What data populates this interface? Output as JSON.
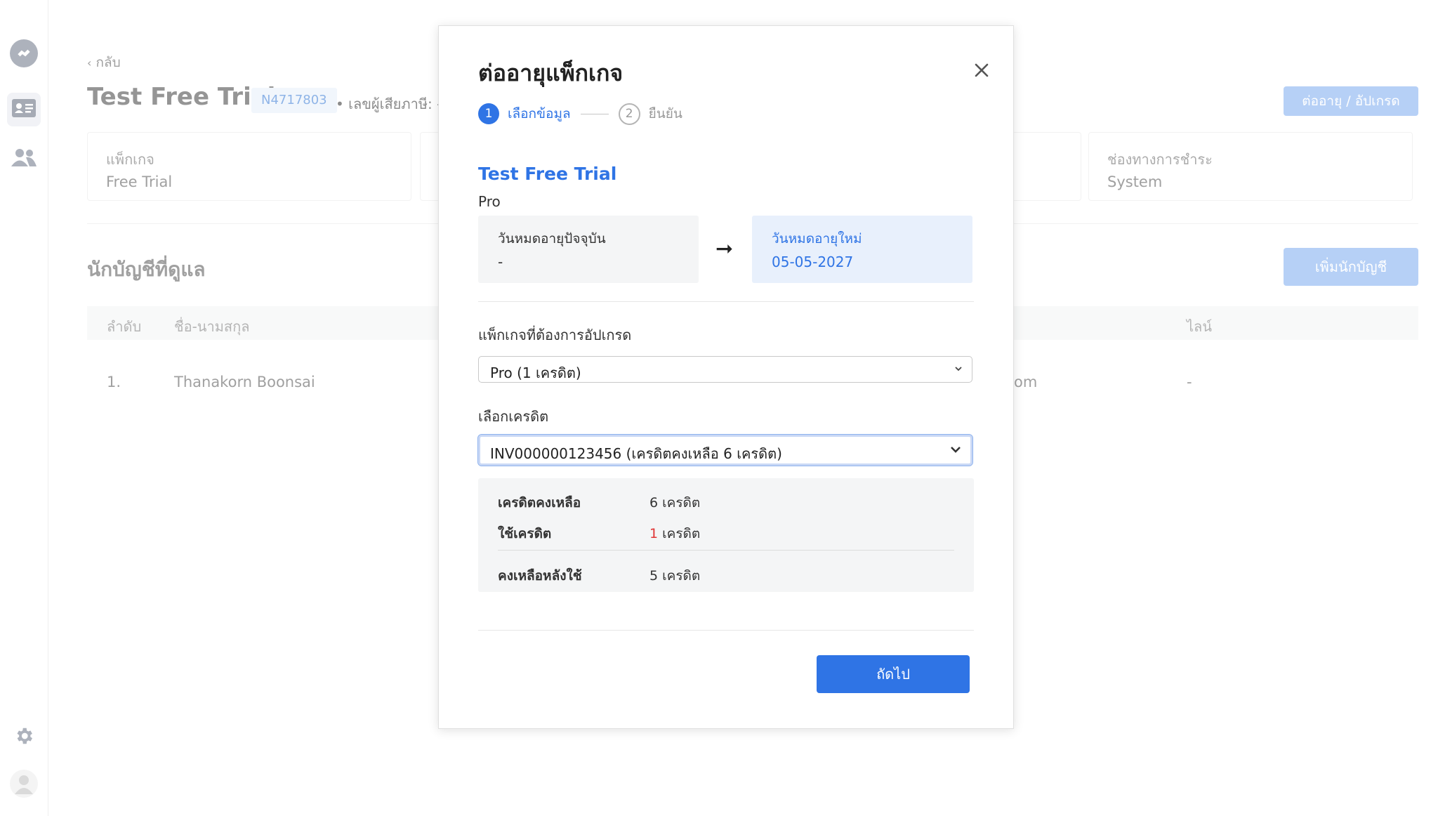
{
  "background": {
    "back_label": "กลับ",
    "page_title": "Test Free Trial",
    "id_badge": "N4717803",
    "tax_label": "• เลขผู้เสียภาษี: -",
    "renew_button": "ต่ออายุ / อัปเกรด",
    "info_cards": [
      {
        "label": "แพ็กเกจ",
        "value": "Free Trial"
      },
      {
        "label": "ช่องทางการชำระ",
        "value": "System"
      }
    ],
    "section_title": "นักบัญชีที่ดูแล",
    "add_button": "เพิ่มนักบัญชี",
    "table": {
      "headers": [
        "ลำดับ",
        "ชื่อ-นามสกุล",
        "ไลน์"
      ],
      "rows": [
        {
          "index": "1.",
          "name": "Thanakorn Boonsai",
          "email_tail": "om",
          "line": "-"
        }
      ]
    }
  },
  "modal": {
    "title": "ต่ออายุแพ็กเกจ",
    "steps": [
      {
        "number": "1",
        "label": "เลือกข้อมูล",
        "active": true
      },
      {
        "number": "2",
        "label": "ยืนยัน",
        "active": false
      }
    ],
    "package_name": "Test Free Trial",
    "package_tier": "Pro",
    "current_expiry": {
      "label": "วันหมดอายุปัจจุบัน",
      "value": "-"
    },
    "new_expiry": {
      "label": "วันหมดอายุใหม่",
      "value": "05-05-2027"
    },
    "upgrade_label": "แพ็กเกจที่ต้องการอัปเกรด",
    "upgrade_selected": "Pro (1 เครดิต)",
    "credit_label": "เลือกเครดิต",
    "credit_selected": "INV000000123456 (เครดิตคงเหลือ 6 เครดิต)",
    "credit_summary": {
      "remaining_label": "เครดิตคงเหลือ",
      "remaining_value": "6 เครดิต",
      "use_label": "ใช้เครดิต",
      "use_number": "1",
      "use_unit": "เครดิต",
      "after_label": "คงเหลือหลังใช้",
      "after_value": "5 เครดิต"
    },
    "next_button": "ถัดไป"
  },
  "colors": {
    "primary": "#2f74e5",
    "primary_light": "#8ab4f0",
    "danger": "#e03535",
    "badge_bg": "#e8f0fb"
  }
}
